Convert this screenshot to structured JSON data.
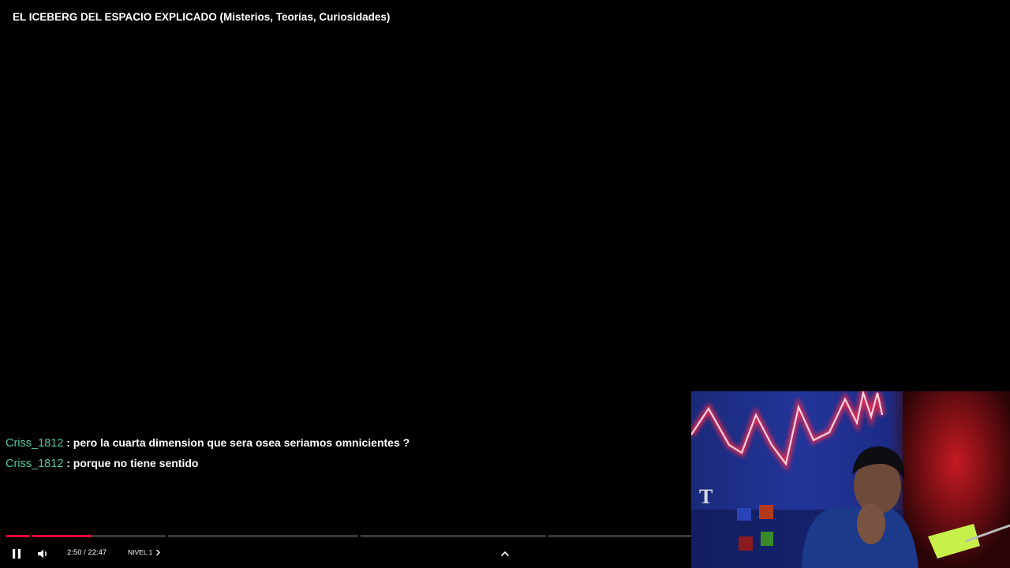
{
  "video": {
    "title": "EL ICEBERG DEL ESPACIO EXPLICADO (Misterios, Teorías, Curiosidades)"
  },
  "chat": {
    "messages": [
      {
        "user": "Criss_1812",
        "separator": " : ",
        "text": "pero la cuarta dimension que sera osea seriamos omnicientes ?"
      },
      {
        "user": "Criss_1812",
        "separator": " : ",
        "text": "porque no tiene sentido"
      }
    ]
  },
  "player": {
    "time_display": "2:50 / 22:47",
    "current_chapter": "NIVEL 1",
    "progress_fraction": 0.1246,
    "play_state": "playing",
    "accent_color": "#ff0033",
    "icons": [
      "pause-icon",
      "volume-icon",
      "chevron-right-icon",
      "chevron-up-icon"
    ]
  },
  "webcam": {
    "neon_color": "#ff2a4a",
    "wall_sign": "T"
  }
}
